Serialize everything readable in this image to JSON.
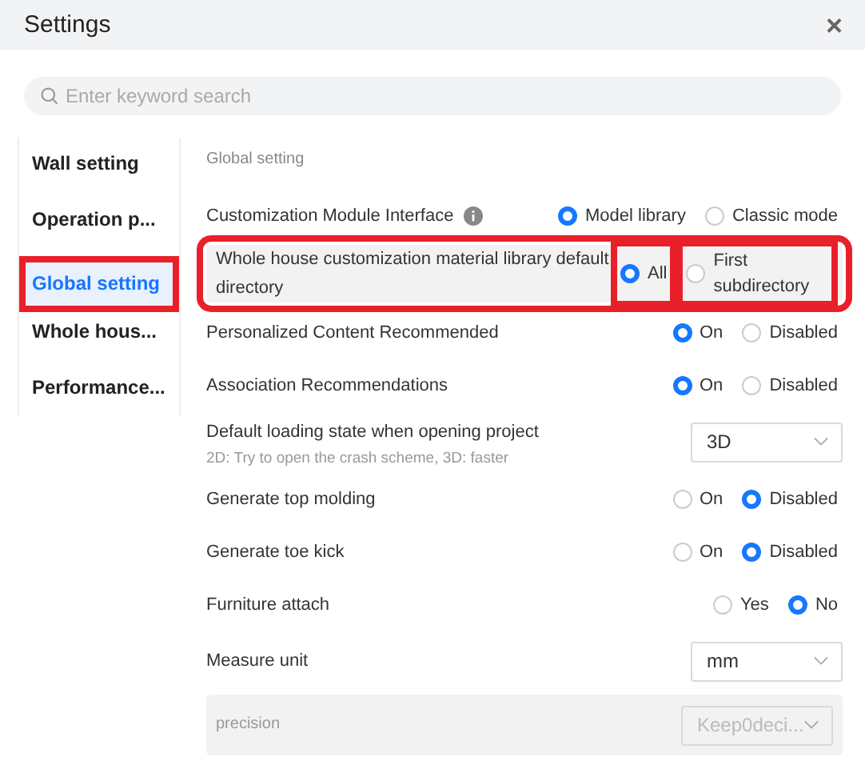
{
  "window": {
    "title": "Settings",
    "close": "×"
  },
  "search": {
    "placeholder": "Enter keyword search"
  },
  "sidebar": {
    "items": [
      {
        "label": "Wall setting",
        "selected": false,
        "highlighted": false
      },
      {
        "label": "Operation p...",
        "selected": false,
        "highlighted": false
      },
      {
        "label": "Global setting",
        "selected": true,
        "highlighted": true
      },
      {
        "label": "Whole hous...",
        "selected": false,
        "highlighted": false
      },
      {
        "label": "Performance...",
        "selected": false,
        "highlighted": false
      }
    ]
  },
  "section_title": "Global setting",
  "rows": [
    {
      "kind": "radio",
      "label": "Customization Module Interface",
      "info": true,
      "options": [
        {
          "label": "Model library",
          "selected": true,
          "highlighted": false
        },
        {
          "label": "Classic mode",
          "selected": false,
          "highlighted": false
        }
      ]
    },
    {
      "kind": "radio",
      "label": "Whole house customization material library default directory",
      "highlighted": true,
      "shaded": true,
      "options": [
        {
          "label": "All",
          "selected": true,
          "highlighted": true
        },
        {
          "label": "First subdirectory",
          "selected": false,
          "highlighted": true
        }
      ]
    },
    {
      "kind": "radio",
      "label": "Personalized Content Recommended",
      "options": [
        {
          "label": "On",
          "selected": true,
          "highlighted": false
        },
        {
          "label": "Disabled",
          "selected": false,
          "highlighted": false
        }
      ]
    },
    {
      "kind": "radio",
      "label": "Association Recommendations",
      "options": [
        {
          "label": "On",
          "selected": true,
          "highlighted": false
        },
        {
          "label": "Disabled",
          "selected": false,
          "highlighted": false
        }
      ]
    },
    {
      "kind": "select",
      "label": "Default loading state when opening project",
      "hint": "2D: Try to open the crash scheme, 3D: faster",
      "value": "3D",
      "disabled": false
    },
    {
      "kind": "radio",
      "label": "Generate top molding",
      "options": [
        {
          "label": "On",
          "selected": false,
          "highlighted": false
        },
        {
          "label": "Disabled",
          "selected": true,
          "highlighted": false
        }
      ]
    },
    {
      "kind": "radio",
      "label": "Generate toe kick",
      "options": [
        {
          "label": "On",
          "selected": false,
          "highlighted": false
        },
        {
          "label": "Disabled",
          "selected": true,
          "highlighted": false
        }
      ]
    },
    {
      "kind": "radio",
      "label": "Furniture attach",
      "options": [
        {
          "label": "Yes",
          "selected": false,
          "highlighted": false
        },
        {
          "label": "No",
          "selected": true,
          "highlighted": false
        }
      ]
    },
    {
      "kind": "select",
      "label": "Measure unit",
      "value": "mm",
      "disabled": false
    },
    {
      "kind": "select",
      "label": "precision",
      "value": "Keep0deci...",
      "disabled": true,
      "shaded": true
    }
  ]
}
